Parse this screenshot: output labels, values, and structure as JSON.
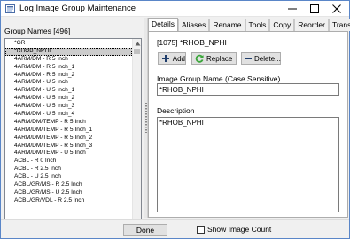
{
  "window": {
    "title": "Log Image Group Maintenance"
  },
  "left": {
    "header": "Group Names [496]",
    "items": [
      "*GR",
      "*RHOB_NPHI",
      "4ARM/DM - R 5 Inch",
      "4ARM/DM - R 5 Inch_1",
      "4ARM/DM - R 5 Inch_2",
      "4ARM/DM - U 5 Inch",
      "4ARM/DM - U 5 Inch_1",
      "4ARM/DM - U 5 Inch_2",
      "4ARM/DM - U 5 Inch_3",
      "4ARM/DM - U 5 Inch_4",
      "4ARM/DM/TEMP - R 5 Inch",
      "4ARM/DM/TEMP - R 5 Inch_1",
      "4ARM/DM/TEMP - R 5 Inch_2",
      "4ARM/DM/TEMP - R 5 Inch_3",
      "4ARM/DM/TEMP - U 5 Inch",
      "ACBL - R 0 Inch",
      "ACBL - R 2.5 Inch",
      "ACBL - U 2.5 Inch",
      "ACBL/GR/MS - R 2.5 Inch",
      "ACBL/GR/MS - U 2.5 Inch",
      "ACBL/GR/VDL - R 2.5 Inch"
    ],
    "selected_index": 1
  },
  "tabs": [
    {
      "label": "Details",
      "active": true
    },
    {
      "label": "Aliases",
      "active": false
    },
    {
      "label": "Rename",
      "active": false
    },
    {
      "label": "Tools",
      "active": false
    },
    {
      "label": "Copy",
      "active": false
    },
    {
      "label": "Reorder",
      "active": false
    },
    {
      "label": "Translate",
      "active": false
    }
  ],
  "details": {
    "record_id": "[1075] *RHOB_NPHI",
    "add_label": "Add",
    "replace_label": "Replace",
    "delete_label": "Delete...",
    "name_label": "Image Group Name (Case Sensitive)",
    "name_value": "*RHOB_NPHI",
    "description_label": "Description",
    "description_value": "*RHOB_NPHI"
  },
  "bottom": {
    "done_label": "Done",
    "show_count_label": "Show Image Count",
    "show_count_checked": false
  },
  "icons": {
    "add": "plus-icon",
    "replace": "refresh-arrow-icon",
    "delete": "minus-icon"
  },
  "colors": {
    "add_icon": "#1f3d6b",
    "replace_icon": "#3aa63a",
    "delete_icon": "#1f3d6b",
    "selected_row": "#cccccc",
    "window_border": "#5a86c8"
  }
}
